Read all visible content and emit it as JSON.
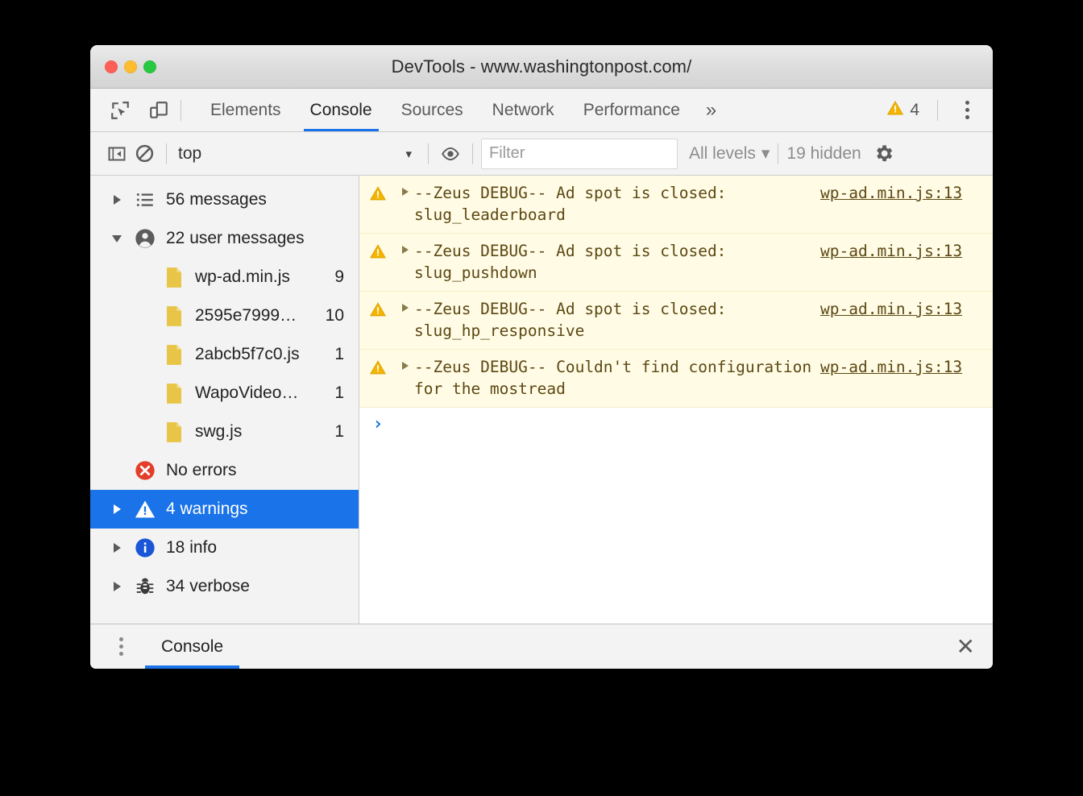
{
  "window": {
    "title": "DevTools - www.washingtonpost.com/",
    "traffic_lights": [
      "close",
      "minimize",
      "zoom"
    ]
  },
  "tabbar": {
    "inspect_icon": "inspect-element-icon",
    "device_icon": "device-toolbar-icon",
    "tabs": [
      {
        "label": "Elements",
        "active": false
      },
      {
        "label": "Console",
        "active": true
      },
      {
        "label": "Sources",
        "active": false
      },
      {
        "label": "Network",
        "active": false
      },
      {
        "label": "Performance",
        "active": false
      }
    ],
    "more_tabs": "»",
    "warning_count": "4",
    "warning_icon": "warning-triangle-icon",
    "menu_icon": "kebab-menu-icon"
  },
  "filterbar": {
    "sidebar_toggle_icon": "console-sidebar-toggle-icon",
    "clear_icon": "clear-console-icon",
    "context": "top",
    "context_caret": "▾",
    "eye_icon": "live-expression-eye-icon",
    "filter_placeholder": "Filter",
    "filter_value": "",
    "levels": "All levels",
    "levels_caret": "▾",
    "hidden": "19 hidden",
    "settings_icon": "settings-gear-icon"
  },
  "sidebar": {
    "items": [
      {
        "label": "56 messages",
        "count": "",
        "icon": "list-icon",
        "twisty": "right",
        "child": false,
        "selected": false
      },
      {
        "label": "22 user messages",
        "count": "",
        "icon": "person-icon",
        "twisty": "down",
        "child": false,
        "selected": false
      },
      {
        "label": "wp-ad.min.js",
        "count": "9",
        "icon": "file-icon",
        "twisty": "none",
        "child": true,
        "selected": false
      },
      {
        "label": "2595e7999…",
        "count": "10",
        "icon": "file-icon",
        "twisty": "none",
        "child": true,
        "selected": false
      },
      {
        "label": "2abcb5f7c0.js",
        "count": "1",
        "icon": "file-icon",
        "twisty": "none",
        "child": true,
        "selected": false
      },
      {
        "label": "WapoVideo…",
        "count": "1",
        "icon": "file-icon",
        "twisty": "none",
        "child": true,
        "selected": false
      },
      {
        "label": "swg.js",
        "count": "1",
        "icon": "file-icon",
        "twisty": "none",
        "child": true,
        "selected": false
      },
      {
        "label": "No errors",
        "count": "",
        "icon": "error-icon",
        "twisty": "none",
        "child": false,
        "selected": false
      },
      {
        "label": "4 warnings",
        "count": "",
        "icon": "warning-icon",
        "twisty": "right",
        "child": false,
        "selected": true
      },
      {
        "label": "18 info",
        "count": "",
        "icon": "info-icon",
        "twisty": "right",
        "child": false,
        "selected": false
      },
      {
        "label": "34 verbose",
        "count": "",
        "icon": "bug-icon",
        "twisty": "right",
        "child": false,
        "selected": false
      }
    ]
  },
  "console": {
    "messages": [
      {
        "level": "warning",
        "text": "--Zeus DEBUG-- Ad spot is closed: slug_leaderboard",
        "source": "wp-ad.min.js:13",
        "expandable": true
      },
      {
        "level": "warning",
        "text": "--Zeus DEBUG-- Ad spot is closed: slug_pushdown",
        "source": "wp-ad.min.js:13",
        "expandable": true
      },
      {
        "level": "warning",
        "text": "--Zeus DEBUG-- Ad spot is closed: slug_hp_responsive",
        "source": "wp-ad.min.js:13",
        "expandable": true
      },
      {
        "level": "warning",
        "text": "--Zeus DEBUG-- Couldn't find configuration for the mostread",
        "source": "wp-ad.min.js:13",
        "expandable": true
      }
    ],
    "prompt_glyph": "›",
    "prompt_value": ""
  },
  "drawer": {
    "menu_icon": "kebab-menu-icon",
    "tab": "Console",
    "close": "✕"
  },
  "colors": {
    "accent_blue": "#1a73e8",
    "warning_amber": "#f5b400",
    "warning_row_bg": "#fffbe5",
    "warning_text": "#5c4813",
    "error_red": "#e33e2b",
    "info_blue": "#1a56d6",
    "file_yellow": "#e8c547",
    "toolbar_bg": "#f3f3f3"
  }
}
